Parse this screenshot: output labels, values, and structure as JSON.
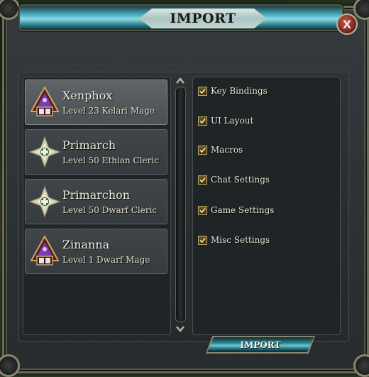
{
  "window": {
    "title": "IMPORT",
    "close_label": "X"
  },
  "characters": [
    {
      "name": "Xenphox",
      "description": "Level 23 Kelari Mage",
      "icon": "mage-icon",
      "selected": true
    },
    {
      "name": "Primarch",
      "description": "Level 50 Ethian Cleric",
      "icon": "cleric-icon",
      "selected": false
    },
    {
      "name": "Primarchon",
      "description": "Level 50 Dwarf Cleric",
      "icon": "cleric-icon",
      "selected": false
    },
    {
      "name": "Zinanna",
      "description": "Level 1 Dwarf Mage",
      "icon": "mage-icon",
      "selected": false
    }
  ],
  "settings": [
    {
      "label": "Key Bindings",
      "checked": true
    },
    {
      "label": "UI Layout",
      "checked": true
    },
    {
      "label": "Macros",
      "checked": true
    },
    {
      "label": "Chat Settings",
      "checked": true
    },
    {
      "label": "Game Settings",
      "checked": true
    },
    {
      "label": "Misc Settings",
      "checked": true
    }
  ],
  "import_button_label": "IMPORT",
  "colors": {
    "accent_teal": "#4fb6c6",
    "checkbox_gold": "#b9a25e",
    "text_light": "#f2efe0"
  }
}
